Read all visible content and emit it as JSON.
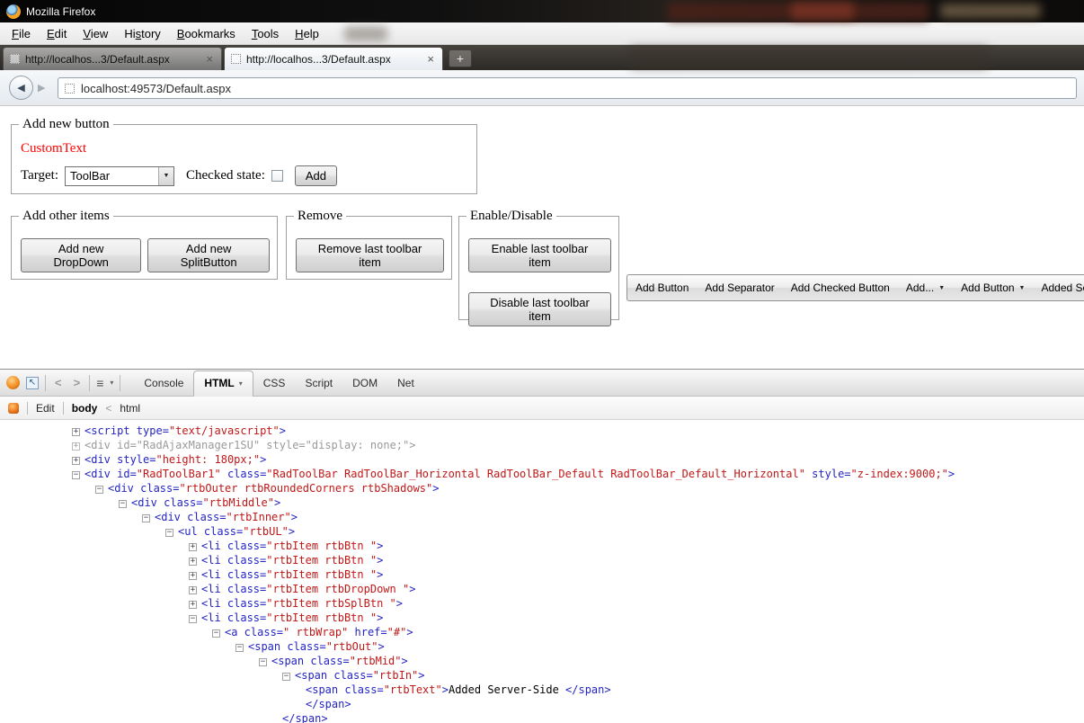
{
  "window": {
    "title": "Mozilla Firefox"
  },
  "icons": {
    "back": "◀",
    "forward": "▶",
    "close_tab": "×",
    "new_tab": "+",
    "dropdown": "▼",
    "dropdown_small": "▾",
    "list": "≡",
    "inspect": "↖",
    "chevron_left": "<",
    "chevron_right": ">"
  },
  "menubar": {
    "items": [
      {
        "label": "File",
        "accel": "F"
      },
      {
        "label": "Edit",
        "accel": "E"
      },
      {
        "label": "View",
        "accel": "V"
      },
      {
        "label": "History",
        "accel": "s"
      },
      {
        "label": "Bookmarks",
        "accel": "B"
      },
      {
        "label": "Tools",
        "accel": "T"
      },
      {
        "label": "Help",
        "accel": "H"
      }
    ]
  },
  "tabs": {
    "items": [
      {
        "title": "http://localhos...3/Default.aspx",
        "active": false
      },
      {
        "title": "http://localhos...3/Default.aspx",
        "active": true
      }
    ]
  },
  "navbar": {
    "url": "localhost:49573/Default.aspx"
  },
  "page": {
    "fieldsets": {
      "add_new_button": {
        "legend": "Add new button",
        "custom_text": "CustomText",
        "custom_text_color": "#ff0000",
        "target_label": "Target:",
        "target_value": "ToolBar",
        "checked_label": "Checked state:",
        "add_button": "Add"
      },
      "add_other": {
        "legend": "Add other items",
        "buttons": [
          "Add new DropDown",
          "Add new SplitButton"
        ]
      },
      "remove": {
        "legend": "Remove",
        "buttons": [
          "Remove last toolbar item"
        ]
      },
      "enable_disable": {
        "legend": "Enable/Disable",
        "buttons": [
          "Enable last toolbar item",
          "Disable last toolbar item"
        ]
      }
    },
    "rad_toolbar": {
      "items": [
        {
          "label": "Add Button",
          "dropdown": false
        },
        {
          "label": "Add Separator",
          "dropdown": false
        },
        {
          "label": "Add Checked Button",
          "dropdown": false
        },
        {
          "label": "Add...",
          "dropdown": true
        },
        {
          "label": "Add Button",
          "dropdown": true
        },
        {
          "label": "Added Server-Side",
          "dropdown": false
        }
      ]
    }
  },
  "firebug": {
    "tabs": [
      {
        "label": "Console",
        "active": false,
        "dropdown": false
      },
      {
        "label": "HTML",
        "active": true,
        "dropdown": true
      },
      {
        "label": "CSS",
        "active": false,
        "dropdown": false
      },
      {
        "label": "Script",
        "active": false,
        "dropdown": false
      },
      {
        "label": "DOM",
        "active": false,
        "dropdown": false
      },
      {
        "label": "Net",
        "active": false,
        "dropdown": false
      }
    ],
    "edit_label": "Edit",
    "breadcrumb": {
      "current": "body",
      "separator": "<",
      "parent": "html"
    },
    "tree": {
      "lines": [
        {
          "indent": 0,
          "twisty": "+",
          "muted": false,
          "tokens": [
            [
              "b",
              "<script type="
            ],
            [
              "r",
              "\"text/javascript\""
            ],
            [
              "b",
              ">"
            ]
          ]
        },
        {
          "indent": 0,
          "twisty": "+",
          "muted": true,
          "tokens": [
            [
              "b",
              "<div id="
            ],
            [
              "r",
              "\"RadAjaxManager1SU\""
            ],
            [
              "b",
              " style="
            ],
            [
              "r",
              "\"display: none;\""
            ],
            [
              "b",
              ">"
            ]
          ]
        },
        {
          "indent": 0,
          "twisty": "+",
          "muted": false,
          "tokens": [
            [
              "b",
              "<div style="
            ],
            [
              "r",
              "\"height: 180px;\""
            ],
            [
              "b",
              ">"
            ]
          ]
        },
        {
          "indent": 0,
          "twisty": "-",
          "muted": false,
          "tokens": [
            [
              "b",
              "<div id="
            ],
            [
              "r",
              "\"RadToolBar1\""
            ],
            [
              "b",
              " class="
            ],
            [
              "r",
              "\"RadToolBar RadToolBar_Horizontal RadToolBar_Default RadToolBar_Default_Horizontal\""
            ],
            [
              "b",
              " style="
            ],
            [
              "r",
              "\"z-index:9000;\""
            ],
            [
              "b",
              ">"
            ]
          ]
        },
        {
          "indent": 1,
          "twisty": "-",
          "muted": false,
          "tokens": [
            [
              "b",
              "<div class="
            ],
            [
              "r",
              "\"rtbOuter rtbRoundedCorners rtbShadows\""
            ],
            [
              "b",
              ">"
            ]
          ]
        },
        {
          "indent": 2,
          "twisty": "-",
          "muted": false,
          "tokens": [
            [
              "b",
              "<div class="
            ],
            [
              "r",
              "\"rtbMiddle\""
            ],
            [
              "b",
              ">"
            ]
          ]
        },
        {
          "indent": 3,
          "twisty": "-",
          "muted": false,
          "tokens": [
            [
              "b",
              "<div class="
            ],
            [
              "r",
              "\"rtbInner\""
            ],
            [
              "b",
              ">"
            ]
          ]
        },
        {
          "indent": 4,
          "twisty": "-",
          "muted": false,
          "tokens": [
            [
              "b",
              "<ul class="
            ],
            [
              "r",
              "\"rtbUL\""
            ],
            [
              "b",
              ">"
            ]
          ]
        },
        {
          "indent": 5,
          "twisty": "+",
          "muted": false,
          "tokens": [
            [
              "b",
              "<li class="
            ],
            [
              "r",
              "\"rtbItem rtbBtn \""
            ],
            [
              "b",
              ">"
            ]
          ]
        },
        {
          "indent": 5,
          "twisty": "+",
          "muted": false,
          "tokens": [
            [
              "b",
              "<li class="
            ],
            [
              "r",
              "\"rtbItem rtbBtn \""
            ],
            [
              "b",
              ">"
            ]
          ]
        },
        {
          "indent": 5,
          "twisty": "+",
          "muted": false,
          "tokens": [
            [
              "b",
              "<li class="
            ],
            [
              "r",
              "\"rtbItem rtbBtn \""
            ],
            [
              "b",
              ">"
            ]
          ]
        },
        {
          "indent": 5,
          "twisty": "+",
          "muted": false,
          "tokens": [
            [
              "b",
              "<li class="
            ],
            [
              "r",
              "\"rtbItem rtbDropDown \""
            ],
            [
              "b",
              ">"
            ]
          ]
        },
        {
          "indent": 5,
          "twisty": "+",
          "muted": false,
          "tokens": [
            [
              "b",
              "<li class="
            ],
            [
              "r",
              "\"rtbItem rtbSplBtn \""
            ],
            [
              "b",
              ">"
            ]
          ]
        },
        {
          "indent": 5,
          "twisty": "-",
          "muted": false,
          "tokens": [
            [
              "b",
              "<li class="
            ],
            [
              "r",
              "\"rtbItem rtbBtn \""
            ],
            [
              "b",
              ">"
            ]
          ]
        },
        {
          "indent": 6,
          "twisty": "-",
          "muted": false,
          "tokens": [
            [
              "b",
              "<a class="
            ],
            [
              "r",
              "\" rtbWrap\""
            ],
            [
              "b",
              " href="
            ],
            [
              "r",
              "\"#\""
            ],
            [
              "b",
              ">"
            ]
          ]
        },
        {
          "indent": 7,
          "twisty": "-",
          "muted": false,
          "tokens": [
            [
              "b",
              "<span class="
            ],
            [
              "r",
              "\"rtbOut\""
            ],
            [
              "b",
              ">"
            ]
          ]
        },
        {
          "indent": 8,
          "twisty": "-",
          "muted": false,
          "tokens": [
            [
              "b",
              "<span class="
            ],
            [
              "r",
              "\"rtbMid\""
            ],
            [
              "b",
              ">"
            ]
          ]
        },
        {
          "indent": 9,
          "twisty": "-",
          "muted": false,
          "tokens": [
            [
              "b",
              "<span class="
            ],
            [
              "r",
              "\"rtbIn\""
            ],
            [
              "b",
              ">"
            ]
          ]
        },
        {
          "indent": 10,
          "twisty": null,
          "muted": false,
          "tokens": [
            [
              "b",
              "<span class="
            ],
            [
              "r",
              "\"rtbText\""
            ],
            [
              "b",
              ">"
            ],
            [
              "k",
              "Added Server-Side "
            ],
            [
              "b",
              "</span>"
            ]
          ]
        },
        {
          "indent": 10,
          "twisty": null,
          "muted": false,
          "tokens": [
            [
              "b",
              "</span>"
            ]
          ]
        },
        {
          "indent": 9,
          "twisty": null,
          "muted": false,
          "tokens": [
            [
              "b",
              "</span>"
            ]
          ]
        }
      ]
    }
  }
}
